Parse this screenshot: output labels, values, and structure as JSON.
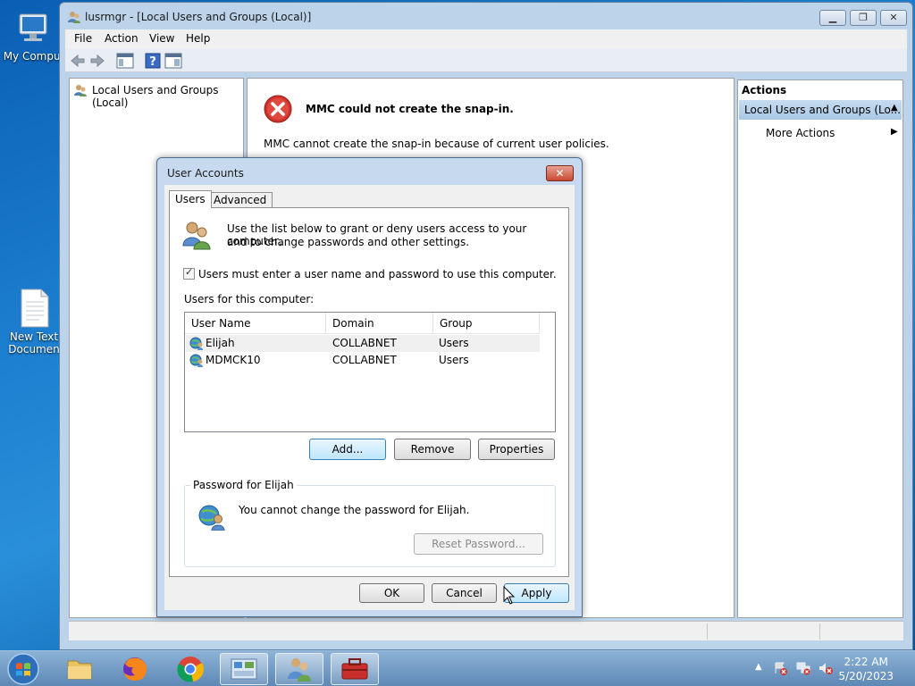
{
  "desktop": {
    "icons": [
      {
        "label": "My Comput"
      },
      {
        "label": "New Text Documen"
      }
    ]
  },
  "window": {
    "title": "lusrmgr - [Local Users and Groups (Local)]",
    "menu": [
      "File",
      "Action",
      "View",
      "Help"
    ],
    "tree_root": "Local Users and Groups (Local)",
    "error_title": "MMC could not create the snap-in.",
    "error_message": "MMC cannot create the snap-in because of current user policies.",
    "actions_header": "Actions",
    "actions_selected": "Local Users and Groups (Lo...",
    "more_actions": "More Actions"
  },
  "dialog": {
    "title": "User Accounts",
    "tabs": [
      "Users",
      "Advanced"
    ],
    "intro_line1": "Use the list below to grant or deny users access to your computer,",
    "intro_line2": "and to change passwords and other settings.",
    "checkbox_label": "Users must enter a user name and password to use this computer.",
    "checkbox_checked": true,
    "users_label": "Users for this computer:",
    "columns": [
      "User Name",
      "Domain",
      "Group"
    ],
    "users": [
      {
        "name": "Elijah",
        "domain": "COLLABNET",
        "group": "Users"
      },
      {
        "name": "MDMCK10",
        "domain": "COLLABNET",
        "group": "Users"
      }
    ],
    "add_label": "Add...",
    "remove_label": "Remove",
    "properties_label": "Properties",
    "password_group_label": "Password for Elijah",
    "password_message": "You cannot change the password for Elijah.",
    "reset_password_label": "Reset Password...",
    "ok_label": "OK",
    "cancel_label": "Cancel",
    "apply_label": "Apply"
  },
  "taskbar": {
    "time": "2:22 AM",
    "date": "5/20/2023"
  }
}
